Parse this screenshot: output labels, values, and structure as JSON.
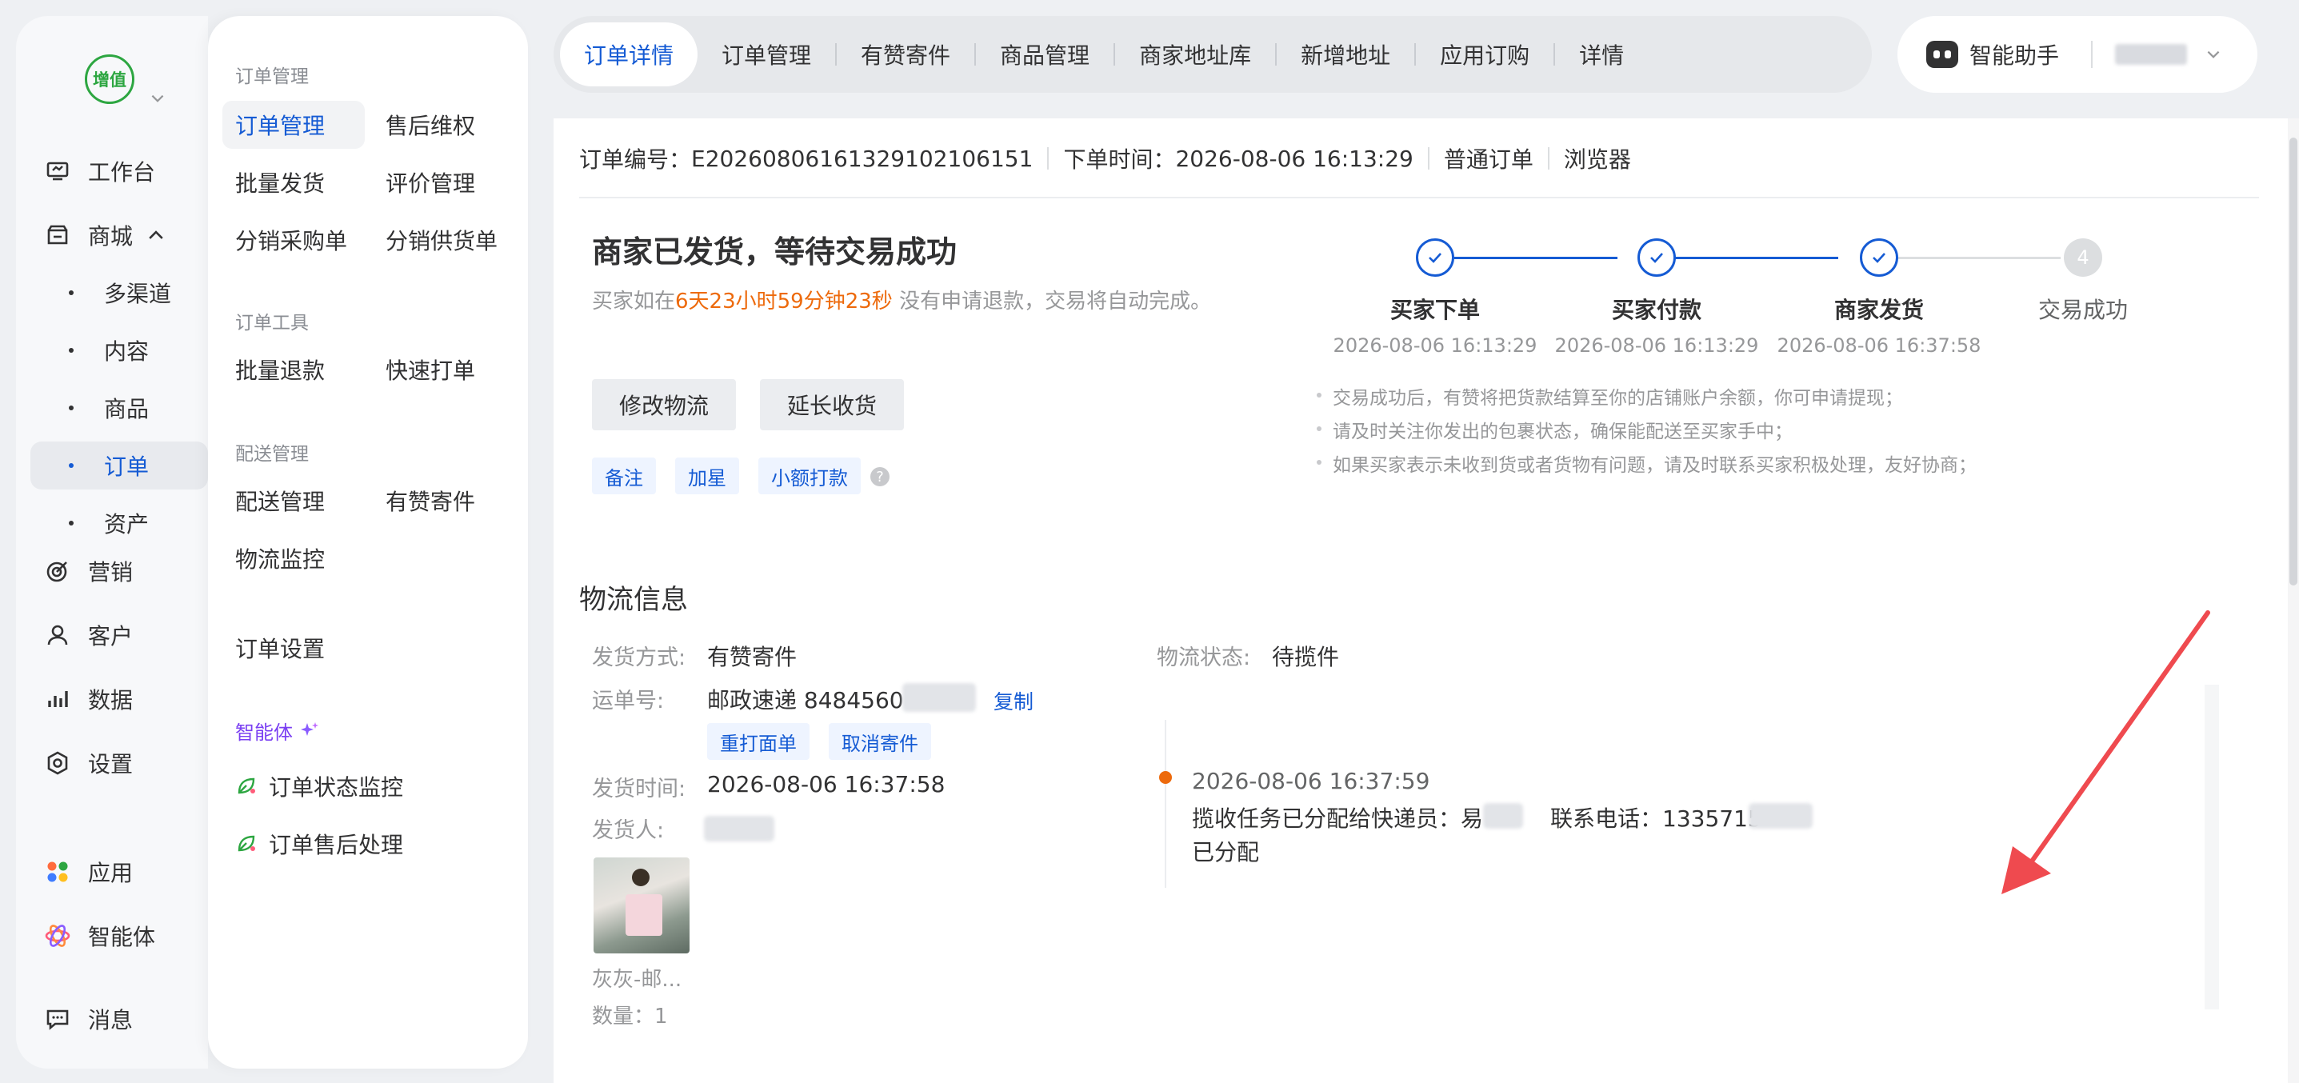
{
  "sidebar": {
    "logo_text": "增值",
    "items": [
      {
        "label": "工作台",
        "icon": "workbench-icon"
      },
      {
        "label": "商城",
        "icon": "store-icon"
      },
      {
        "label": "营销",
        "icon": "target-icon"
      },
      {
        "label": "客户",
        "icon": "user-icon"
      },
      {
        "label": "数据",
        "icon": "bar-chart-icon"
      },
      {
        "label": "设置",
        "icon": "gear-icon"
      },
      {
        "label": "应用",
        "icon": "apps-icon"
      },
      {
        "label": "智能体",
        "icon": "atom-icon"
      },
      {
        "label": "消息",
        "icon": "message-icon"
      }
    ],
    "mall_subitems": [
      "多渠道",
      "内容",
      "商品",
      "订单",
      "资产"
    ],
    "active_subitem": "订单"
  },
  "subnav": {
    "group_order_mgmt": "订单管理",
    "links_order_mgmt": [
      "订单管理",
      "售后维权",
      "批量发货",
      "评价管理",
      "分销采购单",
      "分销供货单"
    ],
    "group_order_tools": "订单工具",
    "links_order_tools": [
      "批量退款",
      "快速打单"
    ],
    "group_delivery": "配送管理",
    "links_delivery": [
      "配送管理",
      "有赞寄件",
      "物流监控"
    ],
    "order_settings": "订单设置",
    "ai_title": "智能体",
    "ai_items": [
      "订单状态监控",
      "订单售后处理"
    ]
  },
  "tabs": [
    "订单详情",
    "订单管理",
    "有赞寄件",
    "商品管理",
    "商家地址库",
    "新增地址",
    "应用订购",
    "详情"
  ],
  "active_tab": "订单详情",
  "assistant": {
    "label": "智能助手"
  },
  "order": {
    "number_label": "订单编号：",
    "number": "E20260806161329102106151",
    "time_label": "下单时间：",
    "time": "2026-08-06 16:13:29",
    "type": "普通订单",
    "source": "浏览器"
  },
  "status": {
    "title": "商家已发货，等待交易成功",
    "desc_prefix": "买家如在",
    "countdown": "6天23小时59分钟23秒",
    "desc_suffix": "没有申请退款，交易将自动完成。",
    "buttons": [
      "修改物流",
      "延长收货"
    ],
    "chips": [
      "备注",
      "加星",
      "小额打款"
    ],
    "help": "?"
  },
  "steps": [
    {
      "label": "买家下单",
      "time": "2026-08-06 16:13:29",
      "done": true
    },
    {
      "label": "买家付款",
      "time": "2026-08-06 16:13:29",
      "done": true
    },
    {
      "label": "商家发货",
      "time": "2026-08-06 16:37:58",
      "done": true
    },
    {
      "label": "交易成功",
      "time": "",
      "done": false,
      "number": "4"
    }
  ],
  "tips": [
    "交易成功后，有赞将把货款结算至你的店铺账户余额，你可申请提现；",
    "请及时关注你发出的包裹状态，确保能配送至买家手中；",
    "如果买家表示未收到货或者货物有问题，请及时联系买家积极处理，友好协商；"
  ],
  "logistics": {
    "title": "物流信息",
    "method_label": "发货方式:",
    "method": "有赞寄件",
    "waybill_label": "运单号:",
    "waybill": "邮政速递 8484560",
    "copy": "复制",
    "reprint": "重打面单",
    "cancel": "取消寄件",
    "ship_time_label": "发货时间:",
    "ship_time": "2026-08-06 16:37:58",
    "shipper_label": "发货人:",
    "product_name": "灰灰-邮...",
    "qty": "数量：1",
    "status_label": "物流状态:",
    "status": "待揽件",
    "event_time": "2026-08-06 16:37:59",
    "event_desc_prefix": "揽收任务已分配给快递员：易",
    "event_phone_label": "联系电话：1335715",
    "event_state": "已分配"
  },
  "colors": {
    "accent": "#155bd4",
    "countdown": "#ed6a0c",
    "success_green": "#2da641",
    "annotation_arrow": "#ef4a4f"
  }
}
